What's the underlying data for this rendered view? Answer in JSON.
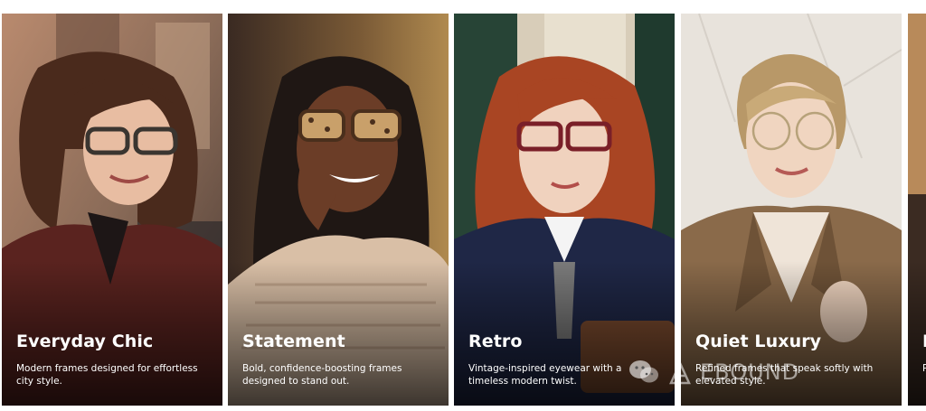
{
  "cards": [
    {
      "title": "Everyday Chic",
      "description": "Modern frames designed for effortless city style."
    },
    {
      "title": "Statement",
      "description": "Bold, confidence-boosting frames designed to stand out."
    },
    {
      "title": "Retro",
      "description": "Vintage-inspired eyewear with a timeless modern twist."
    },
    {
      "title": "Quiet Luxury",
      "description": "Refined frames that speak softly with elevated style."
    },
    {
      "title": "I",
      "description": "P"
    }
  ],
  "watermark": {
    "text": "EBOUND"
  },
  "colors": {
    "text": "#ffffff",
    "page_background": "#ffffff"
  }
}
